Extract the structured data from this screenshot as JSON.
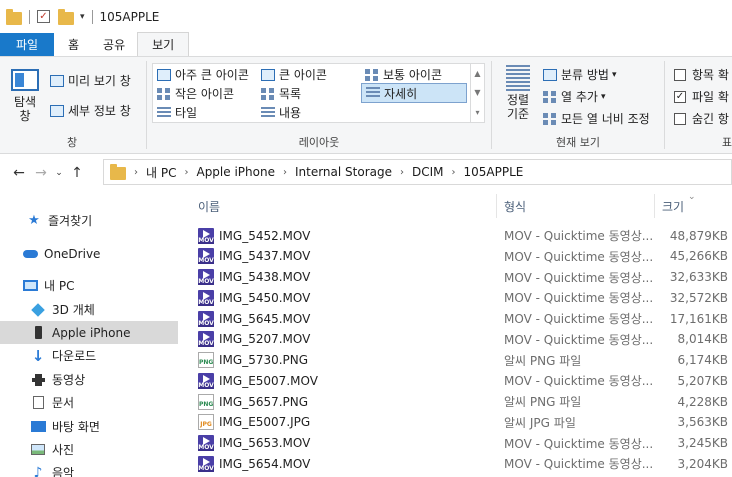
{
  "window": {
    "title": "105APPLE"
  },
  "tabs": [
    {
      "label": "파일"
    },
    {
      "label": "홈"
    },
    {
      "label": "공유"
    },
    {
      "label": "보기"
    }
  ],
  "ribbon": {
    "pane_group": {
      "navigation_pane": "탐색\n창",
      "preview_pane": "미리 보기 창",
      "details_pane": "세부 정보 창",
      "label": "창"
    },
    "layout_group": {
      "items": [
        "아주 큰 아이콘",
        "큰 아이콘",
        "보통 아이콘",
        "작은 아이콘",
        "목록",
        "자세히",
        "타일",
        "내용"
      ],
      "selected": "자세히",
      "label": "레이아웃"
    },
    "current_view_group": {
      "sort_by": "정렬\n기준",
      "group_by": "분류 방법",
      "add_columns": "열 추가",
      "size_all_columns": "모든 열 너비 조정",
      "label": "현재 보기"
    },
    "show_hide_group": {
      "item_checkboxes": "항목 확",
      "file_extensions": "파일 확",
      "hidden_items": "숨긴 항",
      "label": "표",
      "file_extensions_checked": true,
      "item_checkboxes_checked": false,
      "hidden_items_checked": false
    }
  },
  "address": {
    "crumbs": [
      "내 PC",
      "Apple iPhone",
      "Internal Storage",
      "DCIM",
      "105APPLE"
    ]
  },
  "navigation": [
    {
      "label": "즐겨찾기",
      "icon": "star-icon"
    },
    {
      "label": "OneDrive",
      "icon": "cloud-icon"
    },
    {
      "label": "내 PC",
      "icon": "pc-icon"
    },
    {
      "label": "3D 개체",
      "icon": "cube-icon"
    },
    {
      "label": "Apple iPhone",
      "icon": "phone-icon",
      "selected": true
    },
    {
      "label": "다운로드",
      "icon": "download-icon"
    },
    {
      "label": "동영상",
      "icon": "video-icon"
    },
    {
      "label": "문서",
      "icon": "document-icon"
    },
    {
      "label": "바탕 화면",
      "icon": "desktop-icon"
    },
    {
      "label": "사진",
      "icon": "pictures-icon"
    },
    {
      "label": "음악",
      "icon": "music-icon"
    }
  ],
  "columns": {
    "name": "이름",
    "type": "형식",
    "size": "크기"
  },
  "files": [
    {
      "name": "IMG_5452.MOV",
      "type": "MOV - Quicktime 동영상...",
      "size": "48,879KB",
      "kind": "mov"
    },
    {
      "name": "IMG_5437.MOV",
      "type": "MOV - Quicktime 동영상...",
      "size": "45,266KB",
      "kind": "mov"
    },
    {
      "name": "IMG_5438.MOV",
      "type": "MOV - Quicktime 동영상...",
      "size": "32,633KB",
      "kind": "mov"
    },
    {
      "name": "IMG_5450.MOV",
      "type": "MOV - Quicktime 동영상...",
      "size": "32,572KB",
      "kind": "mov"
    },
    {
      "name": "IMG_5645.MOV",
      "type": "MOV - Quicktime 동영상...",
      "size": "17,161KB",
      "kind": "mov"
    },
    {
      "name": "IMG_5207.MOV",
      "type": "MOV - Quicktime 동영상...",
      "size": "8,014KB",
      "kind": "mov"
    },
    {
      "name": "IMG_5730.PNG",
      "type": "알씨 PNG 파일",
      "size": "6,174KB",
      "kind": "png"
    },
    {
      "name": "IMG_E5007.MOV",
      "type": "MOV - Quicktime 동영상...",
      "size": "5,207KB",
      "kind": "mov"
    },
    {
      "name": "IMG_5657.PNG",
      "type": "알씨 PNG 파일",
      "size": "4,228KB",
      "kind": "png"
    },
    {
      "name": "IMG_E5007.JPG",
      "type": "알씨 JPG 파일",
      "size": "3,563KB",
      "kind": "jpg"
    },
    {
      "name": "IMG_5653.MOV",
      "type": "MOV - Quicktime 동영상...",
      "size": "3,245KB",
      "kind": "mov"
    },
    {
      "name": "IMG_5654.MOV",
      "type": "MOV - Quicktime 동영상...",
      "size": "3,204KB",
      "kind": "mov"
    }
  ],
  "file_icon_text": {
    "mov": "MOV",
    "png": "PNG",
    "jpg": "JPG"
  }
}
